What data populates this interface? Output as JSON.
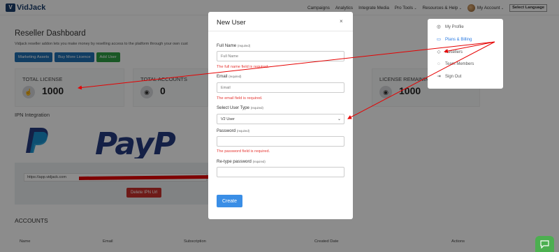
{
  "app": {
    "logo_letter": "V",
    "logo_text": "VidJack"
  },
  "nav": {
    "campaigns": "Campaigns",
    "analytics": "Analytics",
    "integrate_media": "Integrate Media",
    "pro_tools": "Pro Tools",
    "resources_help": "Resources & Help",
    "my_account": "My Account",
    "language": "Select Language"
  },
  "dashboard": {
    "title": "Reseller Dashboard",
    "subtitle": "Vidjack reseller addon lets you make money by reselling access to the platform through your own cust",
    "buttons": {
      "marketing_assets": "Marketing Assets",
      "buy_more_licence": "Buy More Licence",
      "add_user": "Add User"
    },
    "cards": {
      "total_license": {
        "label": "TOTAL LICENSE",
        "value": "1000"
      },
      "total_accounts": {
        "label": "TOTAL ACCOUNTS",
        "value": "0"
      },
      "license_remaining": {
        "label": "LICENSE REMAINING",
        "value": "1000"
      }
    }
  },
  "ipn": {
    "title": "IPN Integration",
    "paypal_wordmark": "PayP",
    "url": "https://app.vidjack.com",
    "delete_button": "Delete IPN Url"
  },
  "accounts": {
    "title": "ACCOUNTS",
    "columns": [
      "Name",
      "Email",
      "Subscription",
      "Created Date",
      "Actions"
    ]
  },
  "modal": {
    "title": "New User",
    "close": "×",
    "required_tag": "(required)",
    "fields": {
      "full_name": {
        "label": "Full Name",
        "placeholder": "Full Name",
        "error": "The full name field is required."
      },
      "email": {
        "label": "Email",
        "placeholder": "Email",
        "error": "The email field is required."
      },
      "user_type": {
        "label": "Select User Type",
        "value": "V2 User"
      },
      "password": {
        "label": "Password",
        "error": "The password field is required."
      },
      "retype_password": {
        "label": "Re-type password"
      }
    },
    "create_button": "Create"
  },
  "account_menu": {
    "items": [
      {
        "label": "My Profile",
        "icon": "user-circle-icon"
      },
      {
        "label": "Plans & Billing",
        "icon": "card-icon"
      },
      {
        "label": "Resellers",
        "icon": "tag-icon"
      },
      {
        "label": "Team Members",
        "icon": "team-icon"
      },
      {
        "label": "Sign Out",
        "icon": "sign-out-icon"
      }
    ]
  },
  "colors": {
    "brand": "#1c3f6e",
    "primary_button": "#1f6fb3",
    "success_button": "#2f9e44",
    "danger_button": "#c9302c",
    "error_text": "#e53935",
    "annotation_arrow": "#e60000",
    "menu_active": "#2a7ae2",
    "chat_button": "#4caf50"
  }
}
